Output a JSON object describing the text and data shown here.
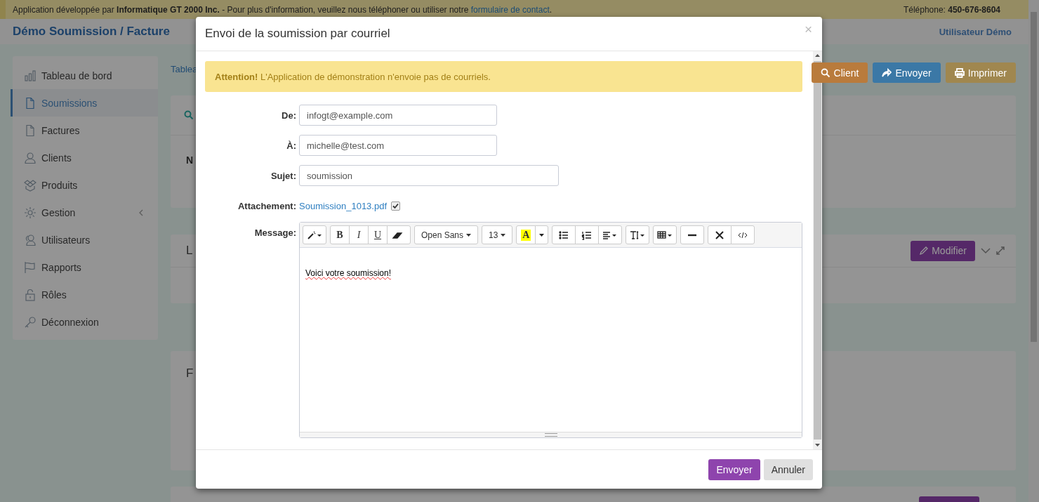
{
  "top_bar": {
    "intro": "Application développée par **Informatique GT 2000 Inc.**  -  Pour plus d'information, veuillez nous téléphoner ou utiliser notre",
    "contact_link": "formulaire de contact",
    "suffix": ".",
    "phone": "Téléphone: **450-676-8604**"
  },
  "header": {
    "app_title": "Démo Soumission / Facture",
    "user": "Utilisateur Démo"
  },
  "sidebar": {
    "items": [
      {
        "label": "Tableau de bord",
        "kind": "chart",
        "selected": false
      },
      {
        "label": "Soumissions",
        "kind": "file",
        "selected": true
      },
      {
        "label": "Factures",
        "kind": "file",
        "selected": false
      },
      {
        "label": "Clients",
        "kind": "user",
        "selected": false
      },
      {
        "label": "Produits",
        "kind": "box",
        "selected": false
      },
      {
        "label": "Gestion",
        "kind": "gear",
        "selected": false,
        "submenu": {
          "expanded": false
        }
      },
      {
        "label": "Utilisateurs",
        "kind": "users",
        "selected": false
      },
      {
        "label": "Rapports",
        "kind": "flag",
        "selected": false
      },
      {
        "label": "Rôles",
        "kind": "lock",
        "selected": false
      },
      {
        "label": "Déconnexion",
        "kind": "key",
        "selected": false
      }
    ]
  },
  "breadcrumb": "Tablea",
  "actions": [
    {
      "label": "Client",
      "kind": "search",
      "color": "#b97b3c"
    },
    {
      "label": "Envoyer",
      "kind": "share",
      "color": "#3b78a6"
    },
    {
      "label": "Imprimer",
      "kind": "print",
      "color": "#a0874f"
    }
  ],
  "panels": [
    {
      "fragment": "N"
    },
    {
      "fragment": "L",
      "button": "Modifier"
    },
    {
      "fragment": "F"
    }
  ],
  "modal": {
    "title": "Envoi de la soumission par courriel",
    "close": "×",
    "alert": "**Attention!** L'Application de démonstration n'envoie pas de courriels.",
    "fields": [
      {
        "label": "De:",
        "value": "infogt@example.com",
        "kind": "short"
      },
      {
        "label": "À:",
        "value": "michelle@test.com",
        "kind": "short"
      },
      {
        "label": "Sujet:",
        "value": "soumission",
        "kind": "long"
      }
    ],
    "attachment": {
      "label": "Attachement:",
      "file": "Soumission_1013.pdf",
      "checked": true
    },
    "message": {
      "label": "Message:",
      "content": "Voici votre soumission!",
      "toolbar": [
        [
          {
            "kind": "style"
          }
        ],
        [
          {
            "kind": "bold",
            "label": "B"
          },
          {
            "kind": "italic",
            "label": "I"
          },
          {
            "kind": "underline",
            "label": "U"
          },
          {
            "kind": "eraser"
          }
        ],
        [
          {
            "kind": "dropdown",
            "label": "Open Sans"
          }
        ],
        [
          {
            "kind": "dropdown",
            "label": "13"
          }
        ],
        [
          {
            "kind": "color",
            "label": "A"
          },
          {
            "kind": "caret"
          }
        ],
        [
          {
            "kind": "ul"
          },
          {
            "kind": "ol"
          },
          {
            "kind": "align"
          }
        ],
        [
          {
            "kind": "height"
          }
        ],
        [
          {
            "kind": "table"
          }
        ],
        [
          {
            "kind": "hr"
          }
        ],
        [
          {
            "kind": "fullscreen"
          },
          {
            "kind": "code"
          }
        ]
      ]
    },
    "buttons": [
      {
        "label": "Envoyer",
        "kind": "primary"
      },
      {
        "label": "Annuler",
        "kind": "default"
      }
    ]
  }
}
